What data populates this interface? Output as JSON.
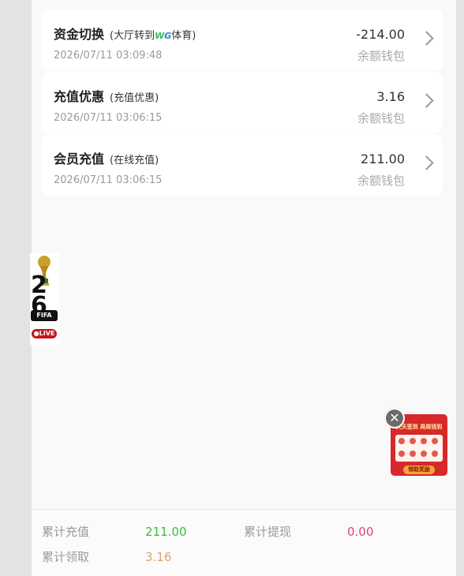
{
  "transactions": [
    {
      "title": "资金切换",
      "subtitle_prefix": "(大厅转到",
      "subtitle_logo_w": "W",
      "subtitle_logo_g": "G",
      "subtitle_suffix": "体育)",
      "date": "2026/07/11 03:09:48",
      "amount": "-214.00",
      "wallet": "余额钱包"
    },
    {
      "title": "充值优惠",
      "subtitle": "(充值优惠)",
      "date": "2026/07/11 03:06:15",
      "amount": "3.16",
      "wallet": "余额钱包"
    },
    {
      "title": "会员充值",
      "subtitle": "(在线充值)",
      "date": "2026/07/11 03:06:15",
      "amount": "211.00",
      "wallet": "余额钱包"
    }
  ],
  "summary": {
    "deposit_label": "累计充值",
    "deposit_value": "211.00",
    "withdraw_label": "累计提现",
    "withdraw_value": "0.00",
    "claim_label": "累计领取",
    "claim_value": "3.16"
  },
  "fifa_badge": {
    "year_top": "2",
    "year_bottom": "6",
    "brand": "FIFA",
    "live": "●LIVE"
  },
  "promo": {
    "close": "✕",
    "title": "天天签到 周周钱到",
    "button": "领取奖励"
  },
  "colors": {
    "deposit_value": "#3cb83c",
    "withdraw_value": "#e2456b",
    "claim_value": "#d9a571",
    "live_badge": "#c4161c"
  }
}
